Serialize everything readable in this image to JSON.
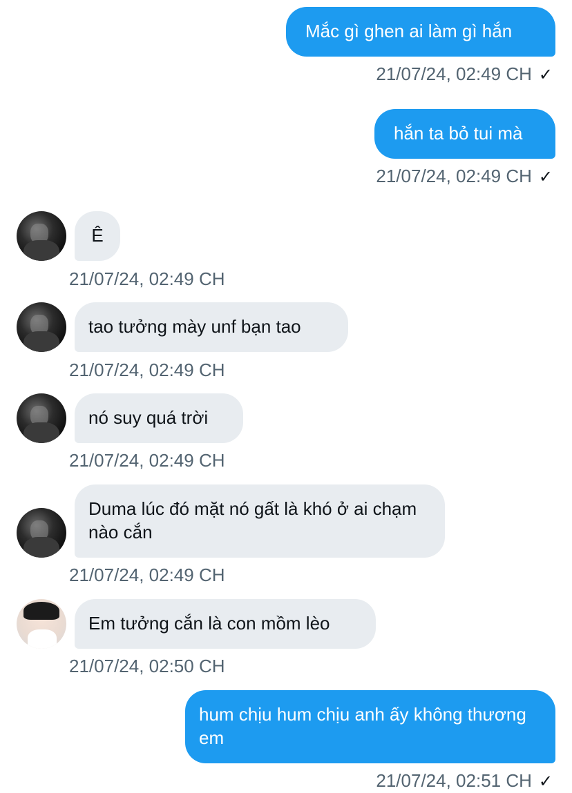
{
  "messages": [
    {
      "direction": "sent",
      "text": "Mắc gì ghen ai làm gì hắn",
      "timestamp": "21/07/24, 02:49 CH"
    },
    {
      "direction": "sent",
      "text": "hắn ta bỏ tui mà",
      "timestamp": "21/07/24, 02:49 CH"
    },
    {
      "direction": "received",
      "text": "Ê",
      "timestamp": "21/07/24, 02:49 CH"
    },
    {
      "direction": "received",
      "text": "tao tưởng mày unf bạn tao",
      "timestamp": "21/07/24, 02:49 CH"
    },
    {
      "direction": "received",
      "text": "nó suy quá trời",
      "timestamp": "21/07/24, 02:49 CH"
    },
    {
      "direction": "received",
      "text": "Duma lúc đó mặt nó gất là khó ở ai chạm nào cắn",
      "timestamp": "21/07/24, 02:49 CH"
    },
    {
      "direction": "received",
      "text": "Em tưởng cắn là con mồm lèo",
      "timestamp": "21/07/24, 02:50 CH"
    },
    {
      "direction": "sent",
      "text": "hum chịu hum chịu anh ấy không thương em",
      "timestamp": "21/07/24, 02:51 CH"
    }
  ],
  "read_receipt_icon": "checkmark-icon",
  "colors": {
    "sent_bubble": "#1d9bf0",
    "received_bubble": "#e8ecf0",
    "timestamp_text": "#536471"
  }
}
